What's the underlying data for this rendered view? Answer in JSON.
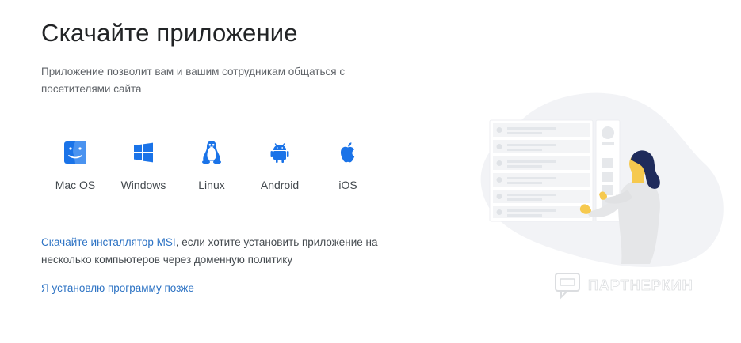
{
  "header": {
    "title": "Скачайте приложение",
    "description": "Приложение позволит вам и вашим сотрудникам общаться с посетителями сайта"
  },
  "platforms": [
    {
      "label": "Mac OS",
      "icon": "macos-icon"
    },
    {
      "label": "Windows",
      "icon": "windows-icon"
    },
    {
      "label": "Linux",
      "icon": "linux-icon"
    },
    {
      "label": "Android",
      "icon": "android-icon"
    },
    {
      "label": "iOS",
      "icon": "apple-icon"
    }
  ],
  "msi": {
    "link_text": "Скачайте инсталлятор MSI",
    "rest_text": ", если хотите установить приложение на несколько компьютеров через доменную политику"
  },
  "later_link": "Я установлю программу позже",
  "watermark": "ПАРТНЕРКИН",
  "colors": {
    "accent": "#1a73e8",
    "link": "#2d73c4",
    "text": "#222426",
    "muted": "#5f6368",
    "figure_skin": "#f6c94e",
    "figure_hair": "#1f2b5b"
  }
}
